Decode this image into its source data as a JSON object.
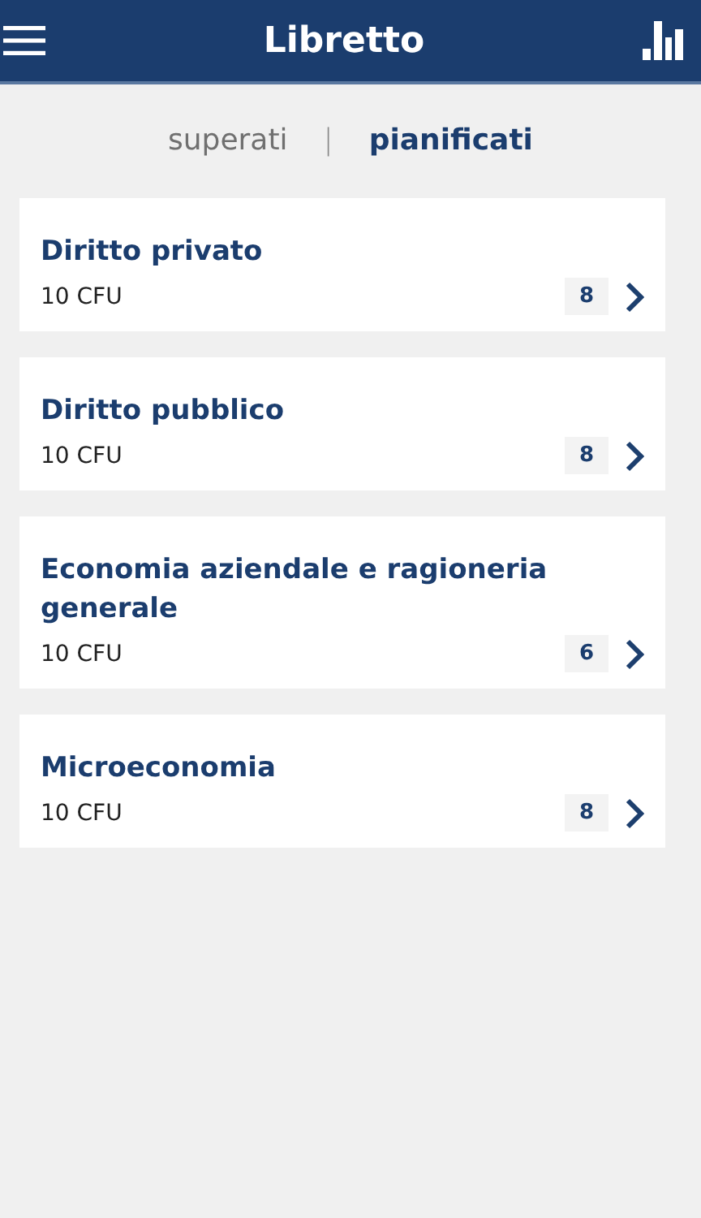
{
  "header": {
    "title": "Libretto"
  },
  "tabs": [
    {
      "label": "superati",
      "selected": false
    },
    {
      "label": "pianificati",
      "selected": true
    }
  ],
  "tab_separator": "|",
  "courses": [
    {
      "name": "Diritto privato",
      "credits": "10 CFU",
      "grade": "8"
    },
    {
      "name": "Diritto pubblico",
      "credits": "10 CFU",
      "grade": "8"
    },
    {
      "name": "Economia aziendale e ragioneria generale",
      "credits": "10 CFU",
      "grade": "6"
    },
    {
      "name": "Microeconomia",
      "credits": "10 CFU",
      "grade": "8"
    }
  ]
}
